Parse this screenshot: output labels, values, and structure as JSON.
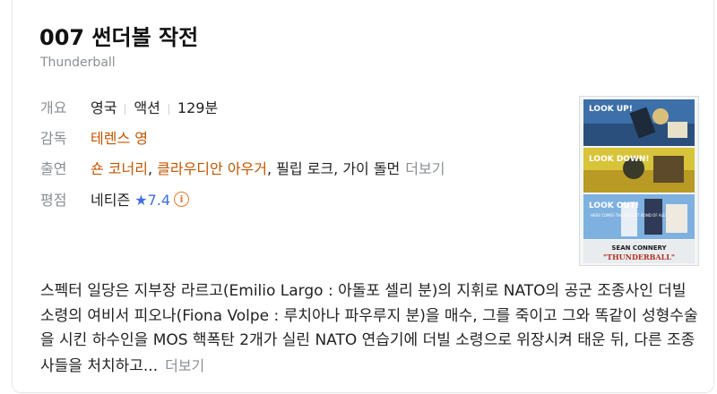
{
  "movie": {
    "title": "007 썬더볼 작전",
    "original_title": "Thunderball"
  },
  "info": {
    "overview_label": "개요",
    "country": "영국",
    "genre": "액션",
    "runtime": "129분",
    "director_label": "감독",
    "director": "테렌스 영",
    "cast_label": "출연",
    "cast": [
      "숀 코너리",
      "클라우디안 아우거",
      "필립 로크",
      "가이 돌먼"
    ],
    "cast_more": "더보기",
    "rating_label": "평점",
    "rating_source": "네티즌",
    "rating_star": "★",
    "rating_value": "7.4",
    "info_icon": "i"
  },
  "poster": {
    "panel1": "LOOK UP!",
    "panel2": "LOOK DOWN!",
    "panel3": "LOOK OUT!",
    "tagline": "HERE COMES THE BIGGEST BOND OF ALL!",
    "star_name": "SEAN CONNERY",
    "film_name": "\"THUNDERBALL\""
  },
  "plot": {
    "text": "스펙터 일당은 지부장 라르고(Emilio Largo : 아돌포 셀리 분)의 지휘로 NATO의 공군 조종사인 더빌 소령의 여비서 피오나(Fiona Volpe : 루치아나 파우루지 분)을 매수, 그를 죽이고 그와 똑같이 성형수술을 시킨 하수인을 MOS 핵폭탄 2개가 실린 NATO 연습기에 더빌 소령으로 위장시켜 태운 뒤, 다른 조종사들을 처치하고...",
    "more": "더보기"
  },
  "colors": {
    "link": "#c05500",
    "rating": "#3f6ee0",
    "label_gray": "#8a8f95"
  }
}
